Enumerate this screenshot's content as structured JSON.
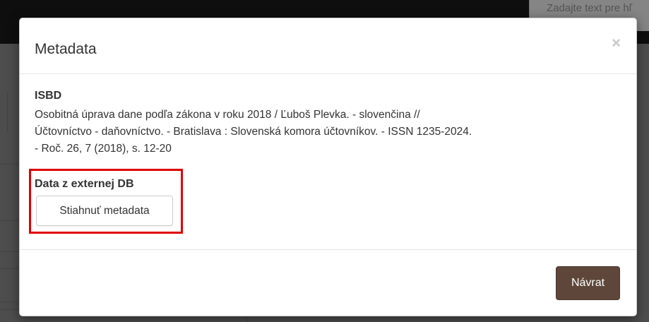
{
  "background": {
    "search_placeholder": "Zadajte text pre hľ"
  },
  "modal": {
    "title": "Metadata",
    "close_label": "×",
    "isbd": {
      "label": "ISBD",
      "lines": [
        "Osobitná úprava dane podľa zákona v roku 2018  / Ľuboš Plevka. - slovenčina //",
        "Účtovníctvo - daňovníctvo. - Bratislava : Slovenská komora účtovníkov. - ISSN 1235-2024.",
        "- Roč. 26, 7 (2018), s. 12-20"
      ]
    },
    "external": {
      "label": "Data z externej DB",
      "download_label": "Stiahnuť metadata"
    },
    "footer": {
      "back_label": "Návrat"
    }
  },
  "colors": {
    "highlight": "#e00000",
    "primary_button": "#5e473a"
  }
}
